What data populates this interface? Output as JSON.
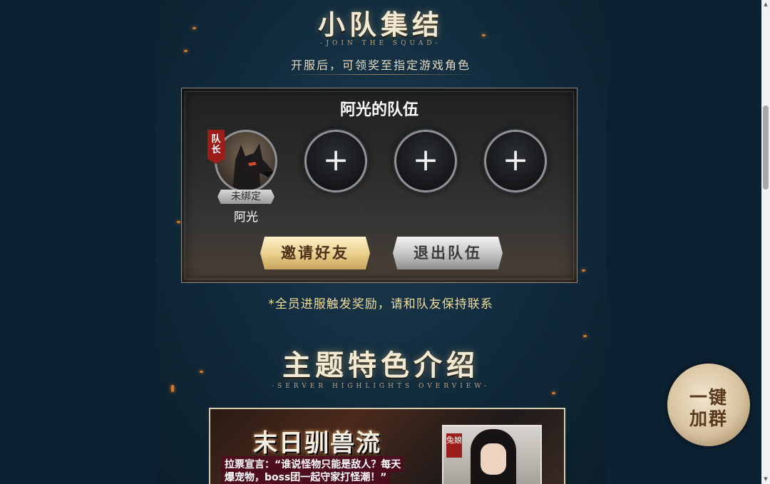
{
  "squad_section": {
    "title": "小队集结",
    "subtitle": "-JOIN THE SQUAD-",
    "description": "开服后，可领奖至指定游戏角色",
    "team_name": "阿光的队伍",
    "leader_tag": "队长",
    "member": {
      "name": "阿光",
      "bind_status": "未绑定"
    },
    "empty_slot_symbol": "+",
    "invite_button": "邀请好友",
    "quit_button": "退出队伍",
    "note": "*全员进服触发奖励，请和队友保持联系"
  },
  "features_section": {
    "title": "主题特色介绍",
    "subtitle": "-SERVER HIGHLIGHTS OVERVIEW-",
    "card": {
      "title": "末日驯兽流",
      "slogan_line1": "拉票宣言：“谁说怪物只能是敌人？每天",
      "slogan_line2": "爆宠物，boss团一起守家打怪潮！”",
      "tag": "兔娘"
    }
  },
  "floating_button": {
    "line1": "一键",
    "line2": "加群"
  },
  "colors": {
    "background": "#0c2232",
    "accent_gold": "#f0dd9d",
    "leader_red": "#9c1e1b"
  },
  "icons": [
    "plus-icon",
    "wolf-avatar-icon"
  ]
}
